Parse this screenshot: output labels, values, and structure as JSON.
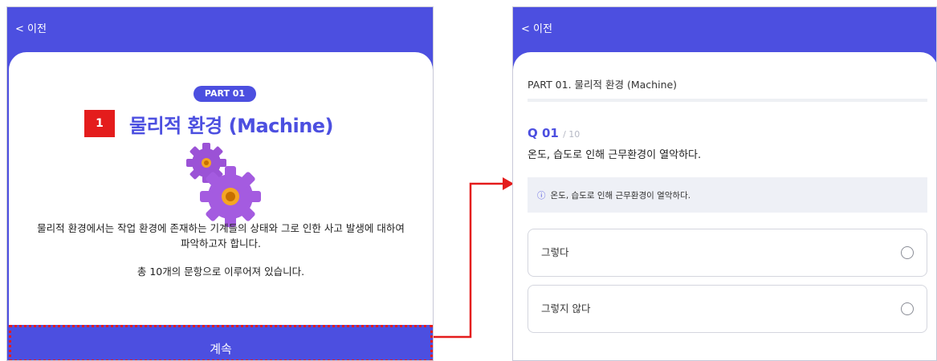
{
  "left": {
    "back_label": "< 이전",
    "badge": "PART 01",
    "marker": "1",
    "title": "물리적 환경 (Machine)",
    "desc_line1": "물리적 환경에서는 작업 환경에 존재하는 기계들의 상태와 그로 인한 사고 발생에 대하여",
    "desc_line2": "파악하고자 합니다.",
    "desc_count": "총 10개의 문항으로 이루어져 있습니다.",
    "continue_label": "계속",
    "gear_icon": "gear-icon",
    "accent": "#4c4fe0",
    "marker_color": "#e41c1c"
  },
  "right": {
    "back_label": "< 이전",
    "header": "PART 01. 물리적 환경 (Machine)",
    "q_label": "Q 01",
    "q_total": "/ 10",
    "question": "온도, 습도로 인해 근무환경이 열악하다.",
    "info_icon": "ⓘ",
    "info_text": "온도, 습도로 인해 근무환경이 열악하다.",
    "options": [
      "그렇다",
      "그렇지 않다"
    ]
  }
}
